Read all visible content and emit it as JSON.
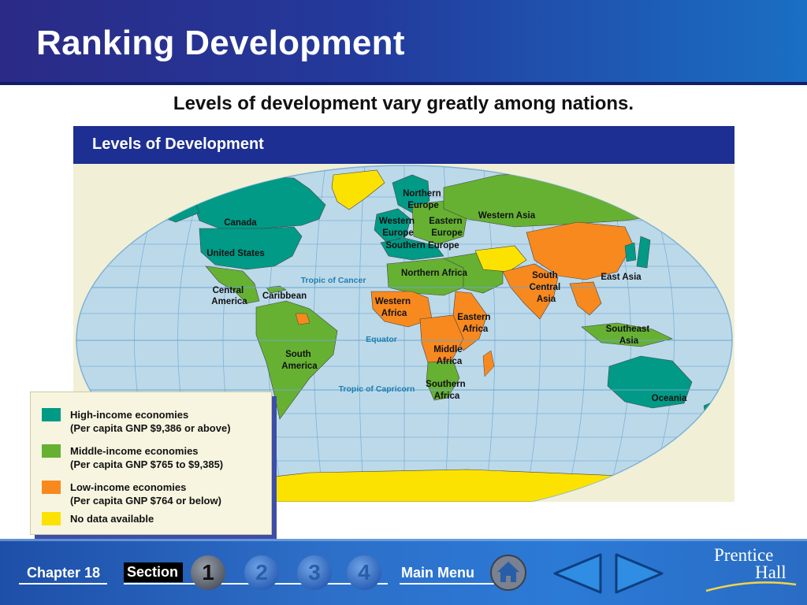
{
  "slide": {
    "title": "Ranking Development",
    "subtitle": "Levels of development vary greatly among nations."
  },
  "map": {
    "title": "Levels of Development",
    "colors": {
      "ocean": "#bcd9ea",
      "high_income": "#009a86",
      "middle_income": "#66b132",
      "low_income": "#f7891f",
      "no_data": "#fce200",
      "title_bar": "#1d2f92"
    },
    "region_labels": [
      "Canada",
      "United States",
      "Central America",
      "Caribbean",
      "South America",
      "Northern Europe",
      "Western Europe",
      "Eastern Europe",
      "Southern Europe",
      "Western Asia",
      "Northern Africa",
      "Western Africa",
      "Eastern Africa",
      "Middle Africa",
      "Southern Africa",
      "South Central Asia",
      "East Asia",
      "Southeast Asia",
      "Oceania"
    ],
    "line_labels": [
      "Tropic of Cancer",
      "Equator",
      "Tropic of Capricorn"
    ]
  },
  "legend": {
    "items": [
      {
        "line1": "High-income economies",
        "line2": "(Per capita GNP $9,386 or above)",
        "color": "#009a86"
      },
      {
        "line1": "Middle-income economies",
        "line2": "(Per capita GNP $765 to $9,385)",
        "color": "#66b132"
      },
      {
        "line1": "Low-income economies",
        "line2": "(Per capita GNP $764 or below)",
        "color": "#f7891f"
      },
      {
        "line1": "No data available",
        "line2": "",
        "color": "#fce200"
      }
    ]
  },
  "footer": {
    "chapter": "Chapter 18",
    "section": "Section",
    "sections": [
      "1",
      "2",
      "3",
      "4"
    ],
    "active_section": "1",
    "main_menu": "Main Menu",
    "logo_line1": "Prentice",
    "logo_line2": "Hall"
  }
}
